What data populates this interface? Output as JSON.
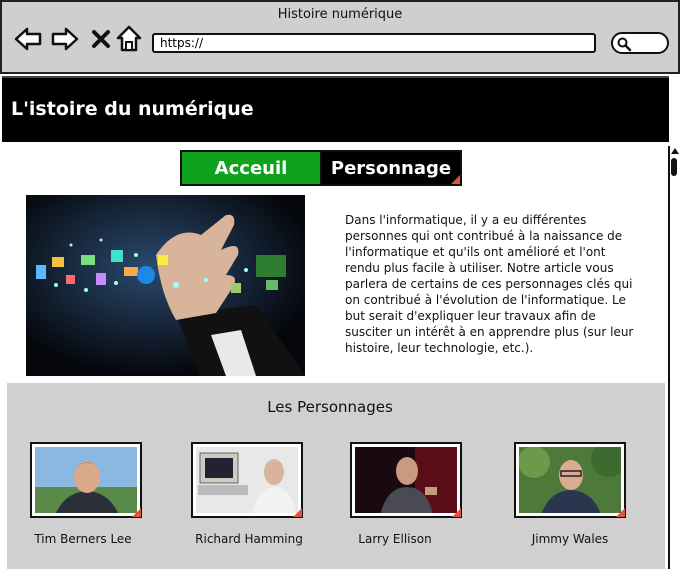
{
  "browser": {
    "window_title": "Histoire numérique",
    "url": "https://",
    "nav_icons": [
      "back-arrow-icon",
      "forward-arrow-icon",
      "stop-x-icon",
      "home-icon"
    ],
    "search_icon": "search-icon"
  },
  "header": {
    "title": "L'istoire du numérique"
  },
  "tabs": [
    {
      "label": "Acceuil",
      "color": "#0fa31d",
      "active": true
    },
    {
      "label": "Personnage",
      "color": "#000000",
      "active": false
    }
  ],
  "intro": {
    "text": "Dans l'informatique, il y a eu différentes personnes qui ont contribué à la naissance de l'informatique et qu'ils ont amélioré et l'ont rendu plus facile à utiliser. Notre article vous parlera de certains de ces personnages clés qui on contribué à l'évolution de l'informatique. Le but serait d'expliquer leur travaux afin de susciter un intérêt à en apprendre plus (sur leur histoire, leur technologie, etc.)."
  },
  "people_section": {
    "heading": "Les Personnages",
    "people": [
      {
        "name": "Tim Berners Lee"
      },
      {
        "name": "Richard Hamming"
      },
      {
        "name": "Larry Ellison"
      },
      {
        "name": "Jimmy Wales"
      }
    ]
  },
  "colors": {
    "chrome": "#cfcfcf",
    "section_bg": "#d0d0d0",
    "accent_green": "#0fa31d",
    "resize_marker": "#e0533c"
  }
}
